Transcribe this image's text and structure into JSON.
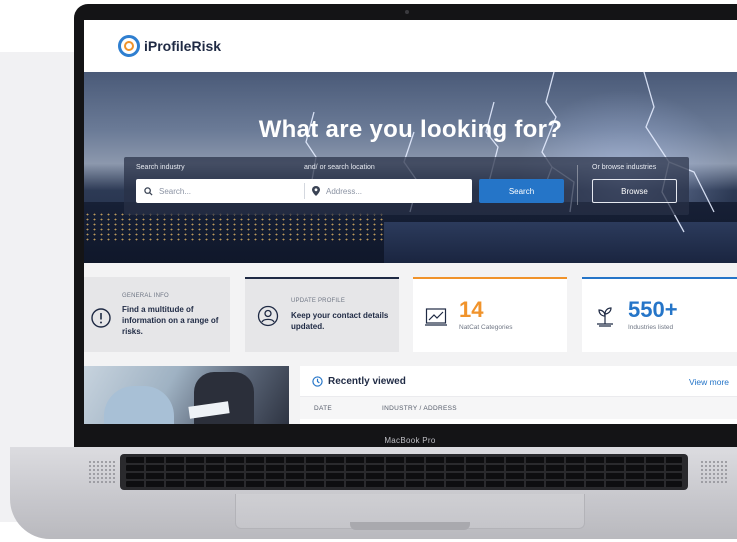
{
  "app": {
    "logo_text": "iProfileRisk"
  },
  "hero": {
    "title": "What are you looking for?",
    "industry_label": "Search industry",
    "location_label": "and/ or search location",
    "search_placeholder": "Search...",
    "address_placeholder": "Address...",
    "search_button": "Search",
    "browse_label": "Or browse industries",
    "browse_button": "Browse"
  },
  "cards": {
    "general_info": {
      "label": "GENERAL INFO",
      "text": "Find a multitude of information on a range of risks."
    },
    "update_profile": {
      "label": "UPDATE PROFILE",
      "text": "Keep your contact details updated."
    },
    "natcat": {
      "number": "14",
      "caption": "NatCat Categories",
      "accent": "#f0932b"
    },
    "industries": {
      "number": "550+",
      "caption": "Industries listed",
      "accent": "#2575c8"
    }
  },
  "recent": {
    "title": "Recently viewed",
    "view_more": "View more",
    "columns": [
      "DATE",
      "INDUSTRY / ADDRESS"
    ]
  },
  "device": {
    "label": "MacBook Pro"
  },
  "colors": {
    "primary": "#2575c8",
    "accent": "#f0932b",
    "text": "#1f2a44"
  }
}
